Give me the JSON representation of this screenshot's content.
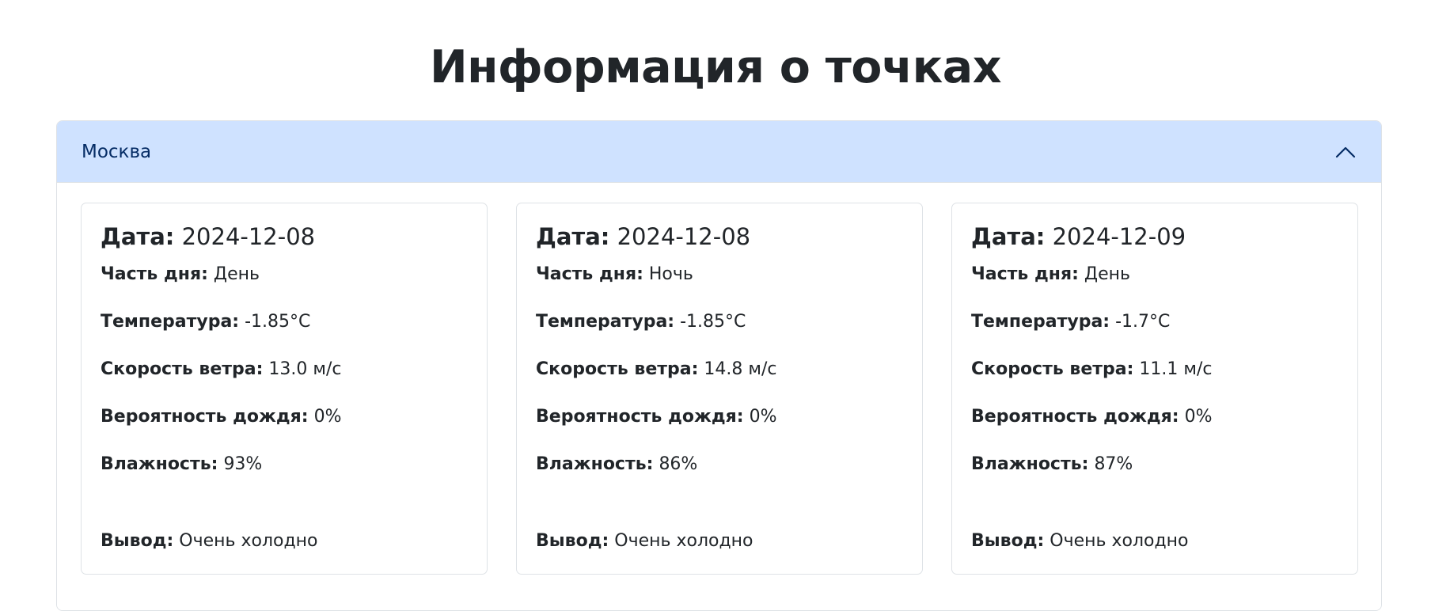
{
  "page": {
    "title": "Информация о точках"
  },
  "accordion": {
    "title": "Москва",
    "expanded": true,
    "toggle_icon": "chevron-up-icon",
    "header_color": "#cfe2ff",
    "labels": {
      "date": "Дата:",
      "part_of_day": "Часть дня:",
      "temperature": "Температура:",
      "wind_speed": "Скорость ветра:",
      "rain_probability": "Вероятность дождя:",
      "humidity": "Влажность:",
      "conclusion": "Вывод:"
    },
    "cards": [
      {
        "date": "2024-12-08",
        "part_of_day": "День",
        "temperature": "-1.85°C",
        "wind_speed": "13.0 м/с",
        "rain_probability": "0%",
        "humidity": "93%",
        "conclusion": "Очень холодно"
      },
      {
        "date": "2024-12-08",
        "part_of_day": "Ночь",
        "temperature": "-1.85°C",
        "wind_speed": "14.8 м/с",
        "rain_probability": "0%",
        "humidity": "86%",
        "conclusion": "Очень холодно"
      },
      {
        "date": "2024-12-09",
        "part_of_day": "День",
        "temperature": "-1.7°C",
        "wind_speed": "11.1 м/с",
        "rain_probability": "0%",
        "humidity": "87%",
        "conclusion": "Очень холодно"
      }
    ]
  }
}
